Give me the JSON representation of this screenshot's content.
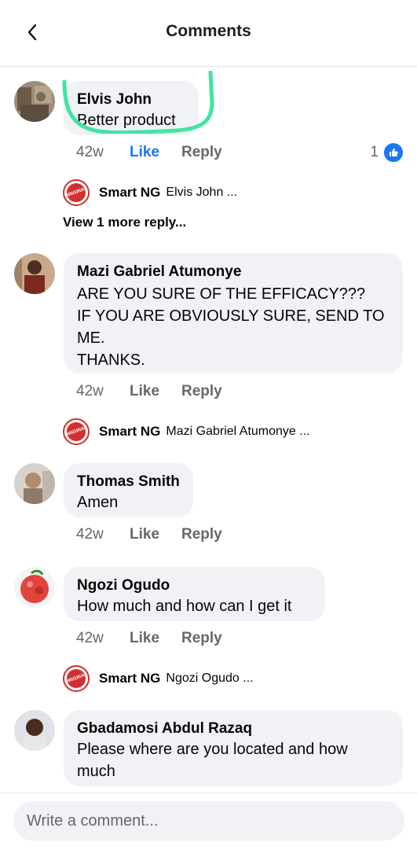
{
  "header": {
    "title": "Comments"
  },
  "comments": [
    {
      "author": "Elvis John",
      "text": "Better product",
      "time": "42w",
      "like_label": "Like",
      "reply_label": "Reply",
      "reaction_count": "1",
      "reply_preview": {
        "author": "Smart NG",
        "text": "Elvis John ..."
      },
      "more_replies": "View 1 more reply..."
    },
    {
      "author": "Mazi Gabriel Atumonye",
      "text": "ARE YOU SURE OF THE EFFICACY???\nIF YOU ARE OBVIOUSLY SURE, SEND TO ME.\nTHANKS.",
      "time": "42w",
      "like_label": "Like",
      "reply_label": "Reply",
      "reply_preview": {
        "author": "Smart NG",
        "text": "Mazi Gabriel Atumonye ..."
      }
    },
    {
      "author": "Thomas Smith",
      "text": "Amen",
      "time": "42w",
      "like_label": "Like",
      "reply_label": "Reply"
    },
    {
      "author": "Ngozi Ogudo",
      "text": "How much and how can I get it",
      "time": "42w",
      "like_label": "Like",
      "reply_label": "Reply",
      "reply_preview": {
        "author": "Smart NG",
        "text": "Ngozi Ogudo ..."
      }
    },
    {
      "author": "Gbadamosi Abdul Razaq",
      "text": "Please where are you located and how much"
    }
  ],
  "composer": {
    "placeholder": "Write a comment..."
  },
  "colors": {
    "accent": "#1877f2",
    "bubble": "#f0f2f5",
    "highlight": "#3ee6a0"
  },
  "icons": [
    "back-arrow-icon",
    "like-reaction-icon"
  ]
}
